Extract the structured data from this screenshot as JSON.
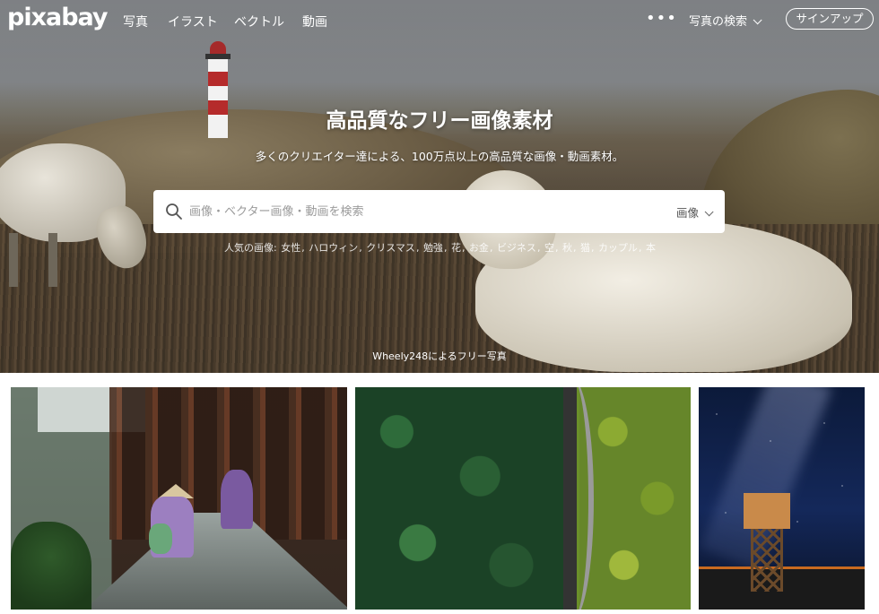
{
  "nav": {
    "logo": "pixabay",
    "links": [
      "写真",
      "イラスト",
      "ベクトル",
      "動画"
    ],
    "more": "•••",
    "explore_label": "写真の検索",
    "signup_label": "サインアップ"
  },
  "hero": {
    "title": "高品質なフリー画像素材",
    "subtitle": "多くのクリエイター達による、100万点以上の高品質な画像・動画素材。",
    "credit": "Wheely248によるフリー写真"
  },
  "search": {
    "placeholder": "画像・ベクター画像・動画を検索",
    "type_label": "画像"
  },
  "popular": {
    "label": "人気の画像:",
    "terms": [
      "女性",
      "ハロウィン",
      "クリスマス",
      "勉強",
      "花",
      "お金",
      "ビジネス",
      "空",
      "秋",
      "猫",
      "カップル",
      "本"
    ]
  },
  "colors": {
    "signup_border": "#ffffff",
    "search_bg": "#ffffff",
    "placeholder": "#9a9a9a"
  }
}
